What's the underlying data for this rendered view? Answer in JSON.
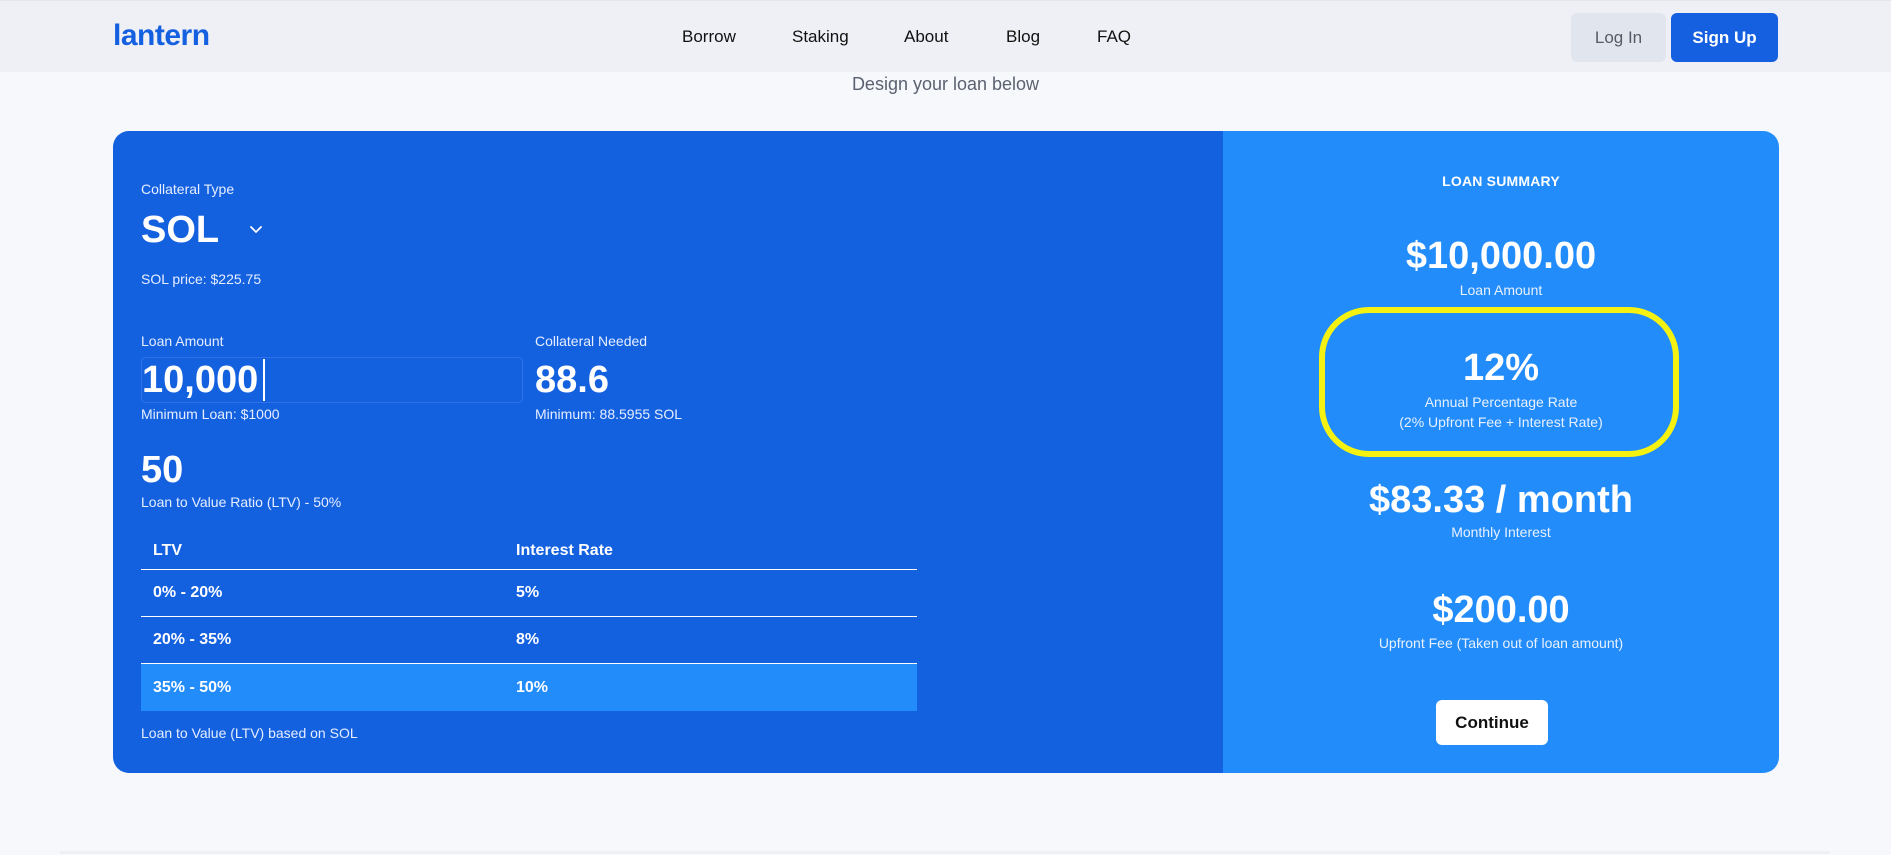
{
  "header": {
    "logo": "lantern",
    "nav": [
      "Borrow",
      "Staking",
      "About",
      "Blog",
      "FAQ"
    ],
    "login": "Log In",
    "signup": "Sign Up"
  },
  "subtitle": "Design your loan below",
  "form": {
    "collateral_type_label": "Collateral Type",
    "collateral_type": "SOL",
    "sol_price": "SOL price: $225.75",
    "loan_amount_label": "Loan Amount",
    "loan_amount": "10,000",
    "min_loan": "Minimum Loan: $1000",
    "collateral_needed_label": "Collateral Needed",
    "collateral_needed": "88.6",
    "collateral_min": "Minimum: 88.5955 SOL",
    "ltv_value": "50",
    "ltv_label": "Loan to Value Ratio (LTV) - 50%",
    "table": {
      "headers": [
        "LTV",
        "Interest Rate"
      ],
      "rows": [
        {
          "ltv": "0% - 20%",
          "rate": "5%"
        },
        {
          "ltv": "20% - 35%",
          "rate": "8%"
        },
        {
          "ltv": "35% - 50%",
          "rate": "10%"
        }
      ],
      "active_row": 2
    },
    "footnote": "Loan to Value (LTV) based on SOL"
  },
  "summary": {
    "title": "LOAN SUMMARY",
    "loan_amount": "$10,000.00",
    "loan_amount_label": "Loan Amount",
    "apr": "12%",
    "apr_label": "Annual Percentage Rate",
    "apr_sub": "(2% Upfront Fee + Interest Rate)",
    "monthly": "$83.33 / month",
    "monthly_label": "Monthly Interest",
    "upfront": "$200.00",
    "upfront_label": "Upfront Fee (Taken out of loan amount)",
    "continue": "Continue"
  },
  "colors": {
    "brand": "#1560e0",
    "panel_left": "#1461e0",
    "panel_right": "#228cfb",
    "highlight": "#f5f211"
  }
}
